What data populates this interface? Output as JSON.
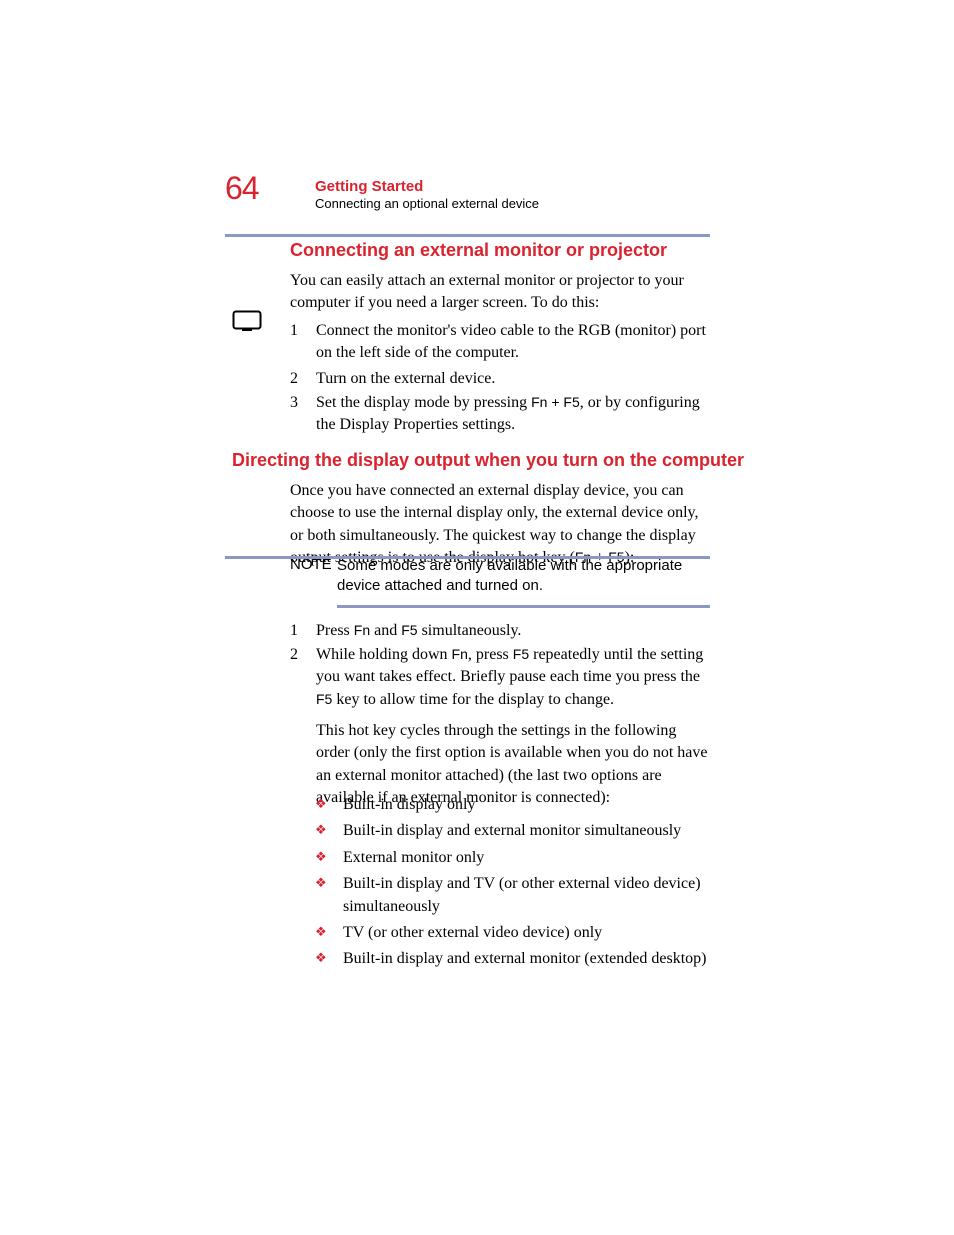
{
  "header": {
    "page_number": "64",
    "chapter_title": "Getting Started",
    "subtitle": "Connecting an optional external device"
  },
  "section1": {
    "heading": "Connecting an external monitor or projector",
    "p1_a": "You can easily attach an external monitor or projector to your computer if you need a larger screen. To do this:",
    "step1": "Connect the monitor's video cable to the RGB (monitor) port on the left side of the computer.",
    "step2": "Turn on the external device.",
    "step3_a": "Set the display mode by pressing ",
    "step3_key": "Fn + F5",
    "step3_b": ", or by configuring the Display Properties settings."
  },
  "section2": {
    "heading": "Directing the display output when you turn on the computer",
    "p1": "Once you have connected an external display device, you can choose to use the internal display only, the external device only, or both simultaneously. The quickest way to change the display output settings is to use the display hot key (",
    "p1_fn": "Fn",
    "p1_plus": " + ",
    "p1_f5": "F5",
    "p1_end": "):"
  },
  "note": {
    "label": "NOTE",
    "body": "Some modes are only available with the appropriate device attached and turned on."
  },
  "steps2": {
    "s1_a": "Press ",
    "s1_fn": "Fn",
    "s1_and": " and ",
    "s1_f5": "F5",
    "s1_b": " simultaneously.",
    "s2_a": "While holding down ",
    "s2_fn": "Fn",
    "s2_b": ", press ",
    "s2_f5": "F5",
    "s2_c": " repeatedly until the setting you want takes effect. Briefly pause each time you press the ",
    "s2_f5b": "F5",
    "s2_d": " key to allow time for the display to change.",
    "s3_a": "This hot key cycles through the settings in the following order (only the first option is available when you do not have an external monitor attached) (the last two options are available if an external monitor is connected):"
  },
  "bullets": {
    "b1": "Built-in display only",
    "b2": "Built-in display and external monitor simultaneously",
    "b3": "External monitor only",
    "b4": "Built-in display and TV (or other external video device) simultaneously",
    "b5": "TV (or other external video device) only",
    "b6": "Built-in display and external monitor (extended desktop)"
  }
}
